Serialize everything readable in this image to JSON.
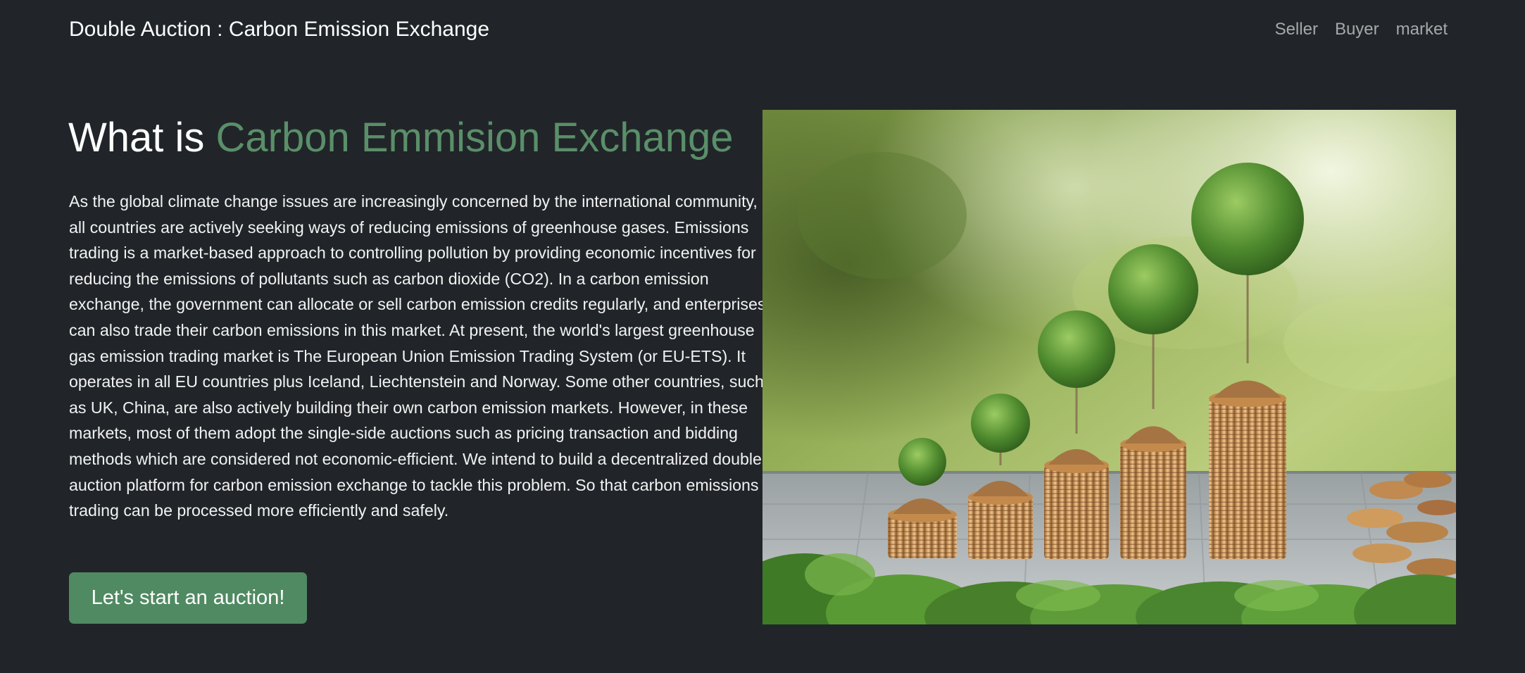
{
  "navbar": {
    "brand": "Double Auction : Carbon Emission Exchange",
    "links": [
      "Seller",
      "Buyer",
      "market"
    ]
  },
  "hero": {
    "title_prefix": "What is",
    "title_accent": "Carbon Emmision Exchange",
    "body": "As the global climate change issues are increasingly concerned by the international community, all countries are actively seeking ways of reducing emissions of greenhouse gases. Emissions trading is a market-based approach to controlling pollution by providing economic incentives for reducing the emissions of pollutants such as carbon dioxide (CO2). In a carbon emission exchange, the government can allocate or sell carbon emission credits regularly, and enterprises can also trade their carbon emissions in this market. At present, the world's largest greenhouse gas emission trading market is The European Union Emission Trading System (or EU-ETS). It operates in all EU countries plus Iceland, Liechtenstein and Norway. Some other countries, such as UK, China, are also actively building their own carbon emission markets. However, in these markets, most of them adopt the single-side auctions such as pricing transaction and bidding methods which are considered not economic-efficient. We intend to build a decentralized double auction platform for carbon emission exchange to tackle this problem. So that carbon emissions trading can be processed more efficiently and safely.",
    "cta_label": "Let's start an auction!",
    "image_subject": "coin-stacks-with-growing-trees-photo"
  },
  "colors": {
    "background": "#212529",
    "accent": "#5a8f69",
    "button": "#508a62"
  }
}
